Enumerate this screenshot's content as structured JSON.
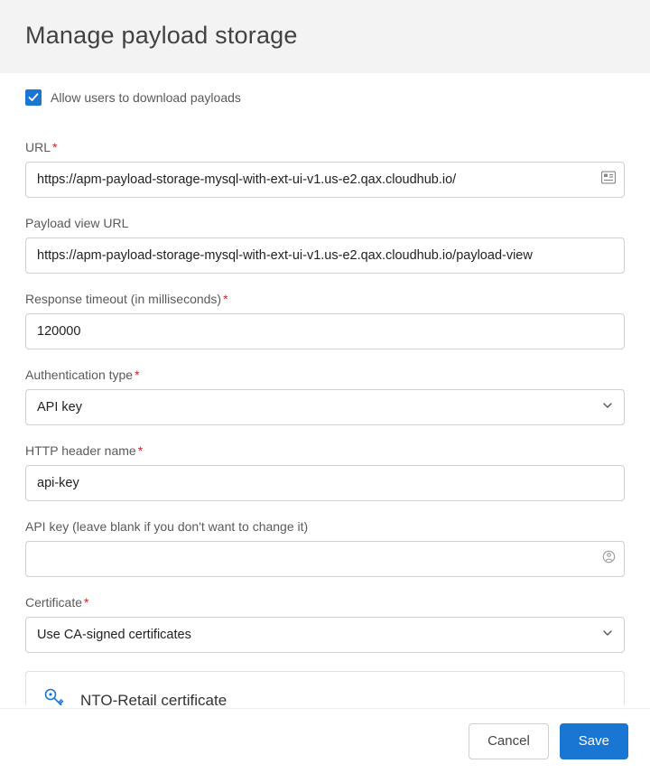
{
  "header": {
    "title": "Manage payload storage"
  },
  "checkbox": {
    "label": "Allow users to download payloads",
    "checked": true
  },
  "fields": {
    "url": {
      "label": "URL",
      "required": true,
      "value": "https://apm-payload-storage-mysql-with-ext-ui-v1.us-e2.qax.cloudhub.io/"
    },
    "payload_view_url": {
      "label": "Payload view URL",
      "required": false,
      "value": "https://apm-payload-storage-mysql-with-ext-ui-v1.us-e2.qax.cloudhub.io/payload-view"
    },
    "response_timeout": {
      "label": "Response timeout (in milliseconds)",
      "required": true,
      "value": "120000"
    },
    "auth_type": {
      "label": "Authentication type",
      "required": true,
      "value": "API key"
    },
    "http_header": {
      "label": "HTTP header name",
      "required": true,
      "value": "api-key"
    },
    "api_key": {
      "label": "API key (leave blank if you don't want to change it)",
      "required": false,
      "value": ""
    },
    "certificate": {
      "label": "Certificate",
      "required": true,
      "value": "Use CA-signed certificates"
    }
  },
  "cert_card": {
    "name": "NTO-Retail certificate"
  },
  "footer": {
    "cancel": "Cancel",
    "save": "Save"
  },
  "asterisk": "*"
}
